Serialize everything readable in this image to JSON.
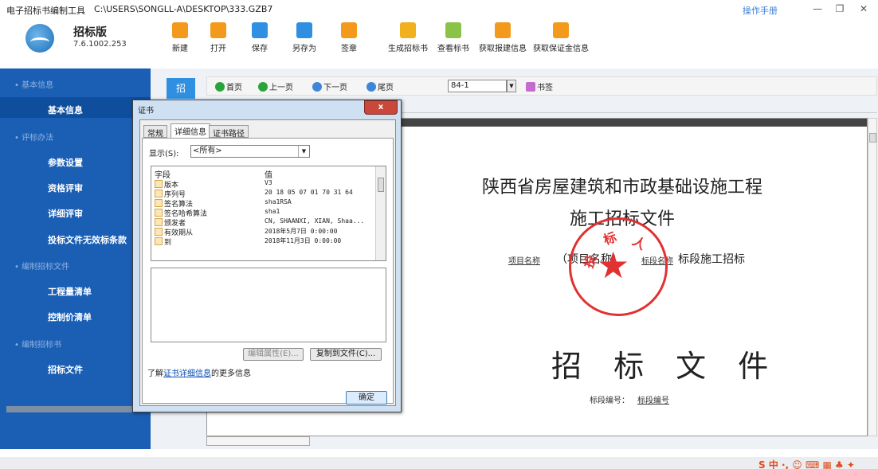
{
  "titlebar": {
    "app_name": "电子招标书编制工具",
    "file_path": "C:\\USERS\\SONGLL-A\\DESKTOP\\333.GZB7",
    "manual_link": "操作手册",
    "minimize": "—",
    "restore": "❐",
    "close": "✕"
  },
  "brand": {
    "edition": "招标版",
    "version": "7.6.1002.253"
  },
  "toolbar": {
    "buttons": [
      {
        "label": "新建",
        "icon": "new-file-icon"
      },
      {
        "label": "打开",
        "icon": "folder-open-icon"
      },
      {
        "label": "保存",
        "icon": "save-icon"
      },
      {
        "label": "另存为",
        "icon": "save-as-icon"
      },
      {
        "label": "签章",
        "icon": "stamp-icon"
      },
      {
        "label": "生成招标书",
        "icon": "generate-doc-icon"
      },
      {
        "label": "查看标书",
        "icon": "view-doc-icon"
      },
      {
        "label": "获取报建信息",
        "icon": "fetch-info-icon"
      },
      {
        "label": "获取保证金信息",
        "icon": "fetch-deposit-icon"
      }
    ]
  },
  "sidebar": {
    "sections": [
      {
        "title": "基本信息",
        "items": [
          "基本信息"
        ]
      },
      {
        "title": "评标办法",
        "items": [
          "参数设置",
          "资格评审",
          "详细评审",
          "投标文件无效标条款"
        ]
      },
      {
        "title": "编制招标文件",
        "items": [
          "工程量清单",
          "控制价清单"
        ]
      },
      {
        "title": "编制招标书",
        "items": [
          "招标文件"
        ]
      }
    ]
  },
  "viewer": {
    "tab_label": "招",
    "nav": {
      "first": "首页",
      "prev": "上一页",
      "next": "下一页",
      "last": "尾页",
      "page": "84-1",
      "bookmark": "书签"
    }
  },
  "document": {
    "title_line1": "陕西省房屋建筑和市政基础设施工程",
    "title_line2": "施工招标文件",
    "project_label": "项目名称",
    "project_value": "（项目名称）",
    "section_label": "标段名称",
    "section_suffix": "标段施工招标",
    "big_title": "招 标 文 件",
    "code_label": "标段编号：",
    "code_value": "标段编号",
    "seal_text": [
      "投",
      "标",
      "人"
    ]
  },
  "dialog": {
    "title": "证书",
    "close": "x",
    "tabs": [
      "常规",
      "详细信息",
      "证书路径"
    ],
    "active_tab": 1,
    "show_label": "显示(S):",
    "show_value": "<所有>",
    "col_field": "字段",
    "col_value": "值",
    "fields": [
      {
        "name": "版本",
        "value": "V3"
      },
      {
        "name": "序列号",
        "value": "20 18 05 07 01 70 31 64"
      },
      {
        "name": "签名算法",
        "value": "sha1RSA"
      },
      {
        "name": "签名哈希算法",
        "value": "sha1"
      },
      {
        "name": "颁发者",
        "value": "CN, SHAANXI, XIAN, Shaa..."
      },
      {
        "name": "有效期从",
        "value": "2018年5月7日 0:00:00"
      },
      {
        "name": "到",
        "value": "2018年11月3日 0:00:00"
      }
    ],
    "edit_props": "编辑属性(E)...",
    "copy_to_file": "复制到文件(C)...",
    "learn_prefix": "了解",
    "learn_link": "证书详细信息",
    "learn_suffix": "的更多信息",
    "ok": "确定"
  },
  "colors": {
    "sidebar_bg": "#1b5fb5",
    "accent": "#2f8fe0",
    "seal": "#e23131"
  }
}
